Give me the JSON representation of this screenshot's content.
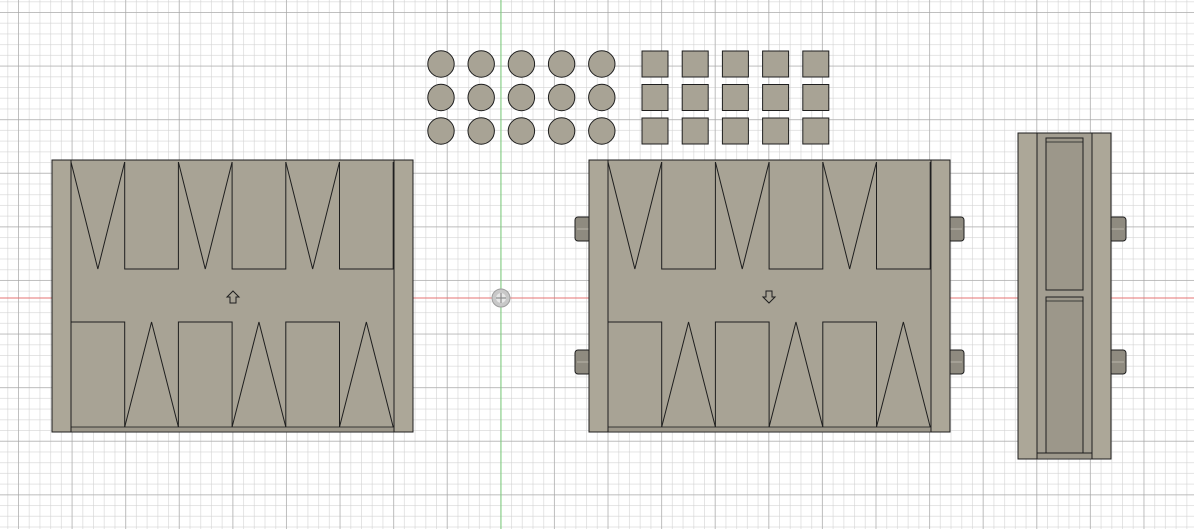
{
  "viewport": {
    "background": "#ffffff",
    "axis_x_color": "#e57373",
    "axis_y_color": "#7ccf7c"
  },
  "materials": {
    "body_fill": "#a8a395",
    "body_fill_light": "#aca798",
    "edge": "#1e1e1e",
    "pin_fill": "#8f8b80",
    "recess_fill": "#9c978a"
  },
  "parts": {
    "round_tokens": {
      "rows": 3,
      "cols": 5
    },
    "square_tokens": {
      "rows": 3,
      "cols": 5
    },
    "left_board": {
      "arrow": "up"
    },
    "right_board": {
      "arrow": "down",
      "hinge_pins": 4
    },
    "side_view": {
      "hinge_pins": 2
    }
  },
  "icons": {
    "origin": "origin-icon",
    "up_arrow": "up-arrow-icon",
    "down_arrow": "down-arrow-icon"
  }
}
